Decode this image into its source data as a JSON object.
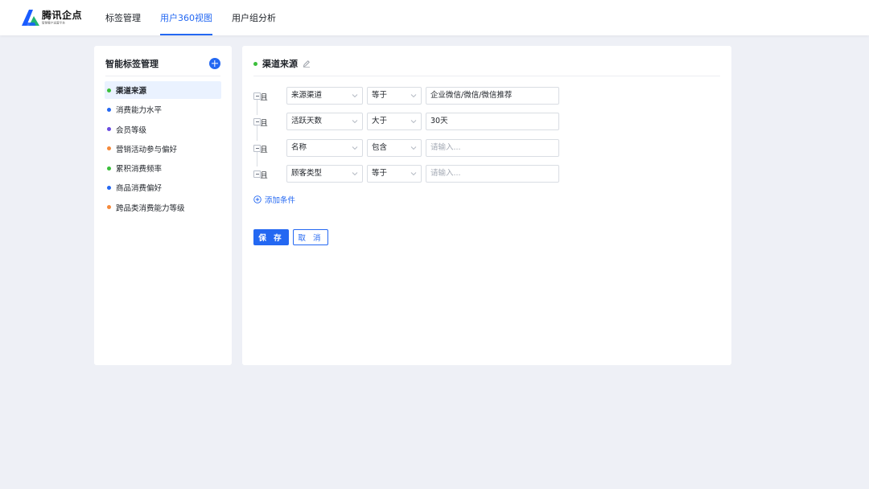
{
  "brand": {
    "name": "腾讯企点",
    "tagline": "智慧客户运营平台",
    "colors": {
      "primary": "#2468f2",
      "logo_blue": "#1a5cff",
      "logo_green": "#22b573"
    }
  },
  "nav": {
    "items": [
      {
        "label": "标签管理",
        "active": false
      },
      {
        "label": "用户360视图",
        "active": true
      },
      {
        "label": "用户组分析",
        "active": false
      }
    ]
  },
  "sidebar": {
    "title": "智能标签管理",
    "add_icon": "plus-circle-icon",
    "items": [
      {
        "label": "渠道来源",
        "color": "#3bbf3b",
        "active": true
      },
      {
        "label": "消费能力水平",
        "color": "#2468f2",
        "active": false
      },
      {
        "label": "会员等级",
        "color": "#6a4ce0",
        "active": false
      },
      {
        "label": "营销活动参与偏好",
        "color": "#f5893a",
        "active": false
      },
      {
        "label": "累积消费频率",
        "color": "#3bbf3b",
        "active": false
      },
      {
        "label": "商品消费偏好",
        "color": "#2468f2",
        "active": false
      },
      {
        "label": "跨品类消费能力等级",
        "color": "#f5893a",
        "active": false
      }
    ]
  },
  "editor": {
    "title": "渠道来源",
    "title_dot_color": "#3bbf3b",
    "edit_icon": "pencil-icon",
    "conditions": [
      {
        "logic": "且",
        "field": "来源渠道",
        "operator": "等于",
        "value": "企业微信/微信/微信推荐",
        "placeholder": ""
      },
      {
        "logic": "且",
        "field": "活跃天数",
        "operator": "大于",
        "value": "30天",
        "placeholder": ""
      },
      {
        "logic": "且",
        "field": "名称",
        "operator": "包含",
        "value": "",
        "placeholder": "请输入..."
      },
      {
        "logic": "且",
        "field": "顾客类型",
        "operator": "等于",
        "value": "",
        "placeholder": "请输入..."
      }
    ],
    "add_condition_label": "添加条件",
    "save_label": "保 存",
    "cancel_label": "取 消"
  }
}
